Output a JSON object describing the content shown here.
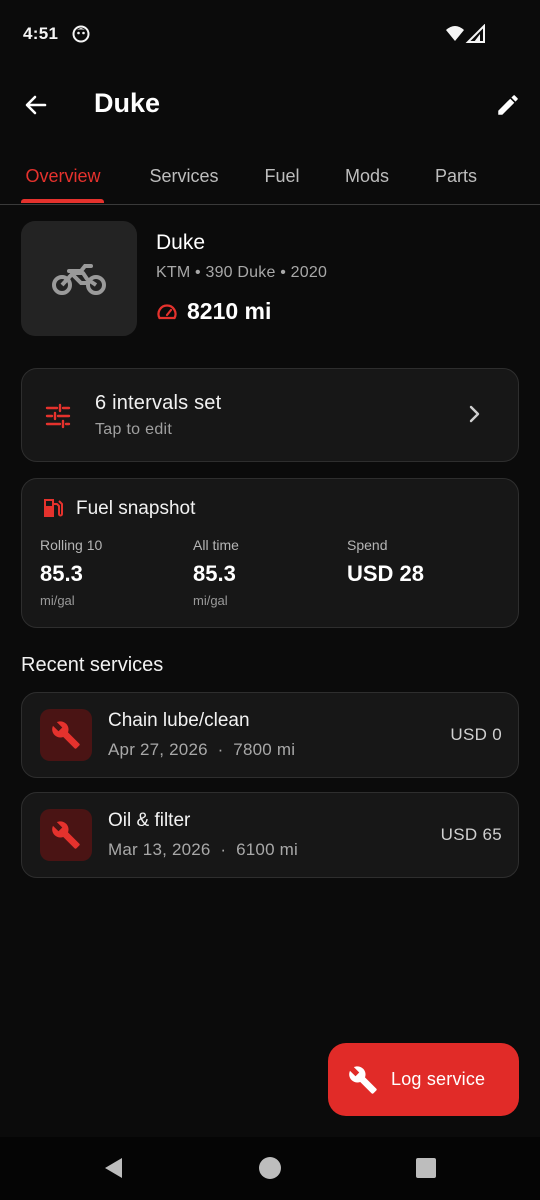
{
  "status_bar": {
    "time": "4:51"
  },
  "app_bar": {
    "title": "Duke"
  },
  "tabs": [
    {
      "label": "Overview",
      "active": true
    },
    {
      "label": "Services",
      "active": false
    },
    {
      "label": "Fuel",
      "active": false
    },
    {
      "label": "Mods",
      "active": false
    },
    {
      "label": "Parts",
      "active": false
    }
  ],
  "bike": {
    "name": "Duke",
    "subtitle": "KTM • 390 Duke • 2020",
    "odometer": "8210 mi"
  },
  "intervals": {
    "title": "6 intervals set",
    "subtitle": "Tap to edit"
  },
  "fuel": {
    "title": "Fuel snapshot",
    "stats": [
      {
        "label": "Rolling 10",
        "value": "85.3",
        "unit": "mi/gal"
      },
      {
        "label": "All time",
        "value": "85.3",
        "unit": "mi/gal"
      },
      {
        "label": "Spend",
        "value": "USD 28",
        "unit": ""
      }
    ]
  },
  "recent_services": {
    "title": "Recent services",
    "items": [
      {
        "title": "Chain lube/clean",
        "meta": "Apr 27, 2026  ·  7800 mi",
        "cost": "USD 0"
      },
      {
        "title": "Oil & filter",
        "meta": "Mar 13, 2026  ·  6100 mi",
        "cost": "USD 65"
      }
    ]
  },
  "fab": {
    "label": "Log service"
  },
  "colors": {
    "accent": "#e5322d",
    "background": "#0b0b0b",
    "card": "#171717"
  },
  "icons": [
    "back-arrow-icon",
    "edit-pencil-icon",
    "motorcycle-icon",
    "speedometer-icon",
    "sliders-icon",
    "chevron-right-icon",
    "fuel-pump-icon",
    "wrench-icon"
  ]
}
